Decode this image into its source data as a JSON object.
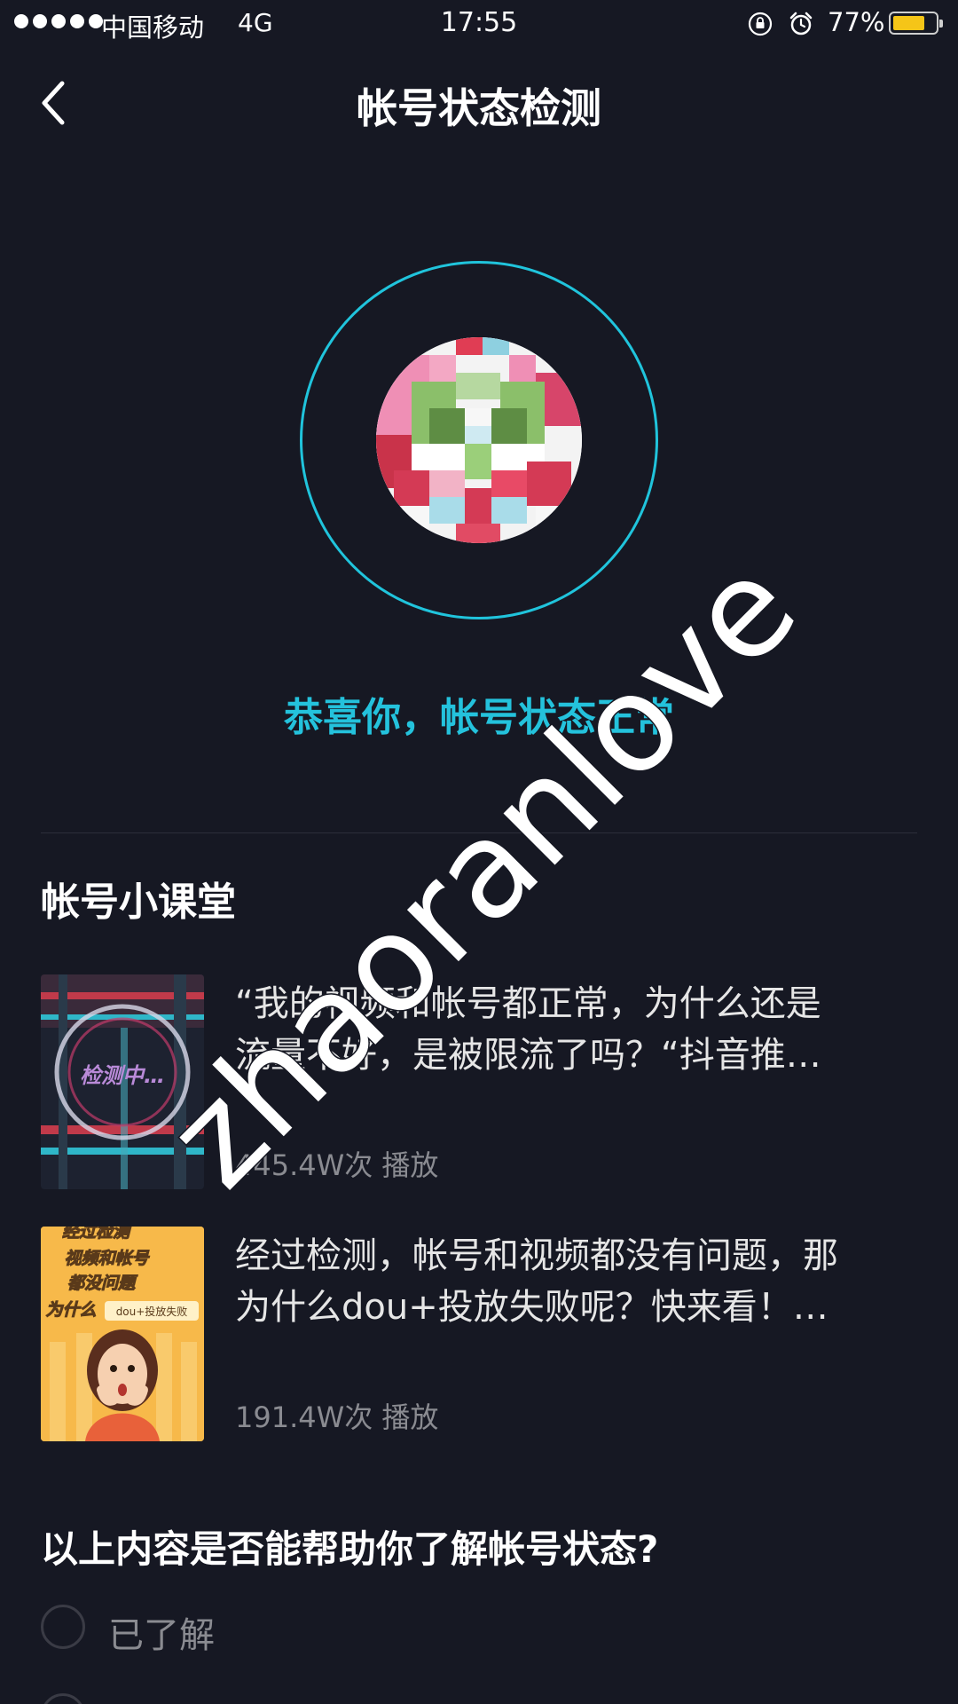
{
  "status_bar": {
    "carrier": "中国移动",
    "network": "4G",
    "time": "17:55",
    "battery_percent_text": "77%",
    "battery_level": 0.77,
    "icons": [
      "signal-dots-icon",
      "rotation-lock-icon",
      "alarm-icon",
      "battery-icon"
    ]
  },
  "nav": {
    "back_icon": "chevron-left-icon",
    "title": "帐号状态检测"
  },
  "result": {
    "status_text": "恭喜你，帐号状态正常",
    "accent_color": "#24c2dc"
  },
  "course": {
    "section_title": "帐号小课堂",
    "items": [
      {
        "title_line1": "“我的视频和帐号都正常，为什么还是",
        "title_line2": "流量不好，是被限流了吗？“抖音推…",
        "plays": "445.4W次 播放",
        "thumb_text": "检测中…"
      },
      {
        "title_line1": "经过检测，帐号和视频都没有问题，那",
        "title_line2": "为什么dou+投放失败呢？快来看！…",
        "plays": "191.4W次 播放",
        "thumb_line1": "经过检测",
        "thumb_line2": "视频和帐号",
        "thumb_line3": "都没问题",
        "thumb_line4": "为什么",
        "thumb_tag": "dou+投放失败"
      }
    ]
  },
  "survey": {
    "question": "以上内容是否能帮助你了解帐号状态?",
    "options": [
      "已了解"
    ]
  },
  "watermark": "zhaoranlove",
  "colors": {
    "background": "#161823",
    "accent": "#24c2dc",
    "battery": "#f5c518"
  }
}
